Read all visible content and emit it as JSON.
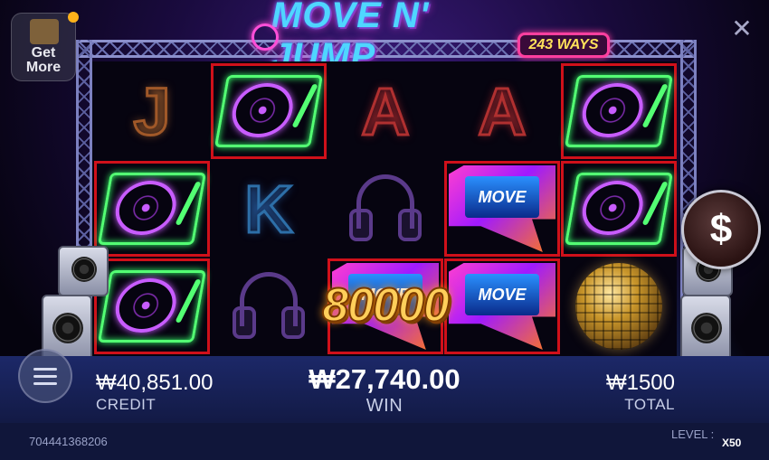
{
  "header": {
    "logo_title": "MOVE N' JUMP",
    "ways_badge": "243 WAYS",
    "get_more_label": "Get More"
  },
  "reels": {
    "columns": [
      [
        "J",
        "turntable",
        "turntable"
      ],
      [
        "turntable",
        "K",
        "headphones"
      ],
      [
        "A",
        "headphones",
        "move-wild"
      ],
      [
        "A",
        "move-wild",
        "move-wild"
      ],
      [
        "turntable",
        "turntable",
        "disco-ball"
      ]
    ],
    "winning_cells": [
      [
        1,
        0
      ],
      [
        0,
        1
      ],
      [
        4,
        0
      ],
      [
        0,
        2
      ],
      [
        3,
        1
      ],
      [
        4,
        1
      ],
      [
        2,
        2
      ],
      [
        3,
        2
      ]
    ],
    "wild_label": "MOVE"
  },
  "win_popup": "80000",
  "spin_button_symbol": "$",
  "stats": {
    "credit_value": "₩40,851.00",
    "credit_label": "CREDIT",
    "win_value": "₩27,740.00",
    "win_label": "WIN",
    "total_value": "₩1500",
    "total_label": "TOTAL"
  },
  "footer": {
    "round_id": "704441368206",
    "level_label": "LEVEL :",
    "level_value": "X50"
  },
  "colors": {
    "win_frame": "#d0101a",
    "neon_green": "#53ff73",
    "neon_purple": "#c85cff",
    "gold": "#ffcf5a"
  }
}
